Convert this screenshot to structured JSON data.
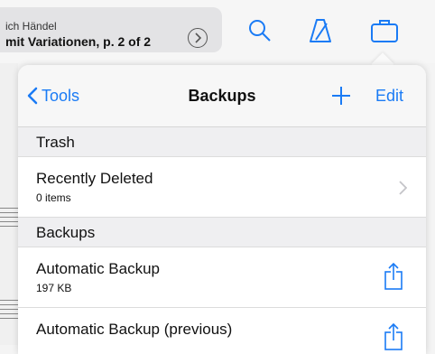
{
  "toolbar": {
    "composer": "ich Händel",
    "piece": "mit Variationen, p. 2 of 2",
    "icons": [
      "chevron-right-icon",
      "search-icon",
      "metronome-icon",
      "briefcase-icon"
    ]
  },
  "popover": {
    "back_label": "Tools",
    "title": "Backups",
    "edit_label": "Edit",
    "accent": "#1a7bf5",
    "sections": {
      "trash": {
        "header": "Trash",
        "rows": [
          {
            "title": "Recently Deleted",
            "subtitle": "0 items"
          }
        ]
      },
      "backups": {
        "header": "Backups",
        "rows": [
          {
            "title": "Automatic Backup",
            "subtitle": "197 KB"
          },
          {
            "title": "Automatic Backup (previous)",
            "subtitle": ""
          }
        ]
      }
    }
  }
}
